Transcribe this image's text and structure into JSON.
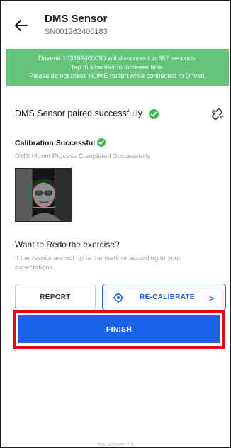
{
  "header": {
    "title": "DMS Sensor",
    "serial": "SN001262400183"
  },
  "banner": {
    "line1": "Driveri# 103182400090 will disconnect in 357 seconds.",
    "line2": "Tap this banner to increase time.",
    "line3": "Please do not press HOME button while connected to Driveri.",
    "color": "#66c37c"
  },
  "pairing": {
    "status_text": "DMS Sensor paired successfully",
    "status_icon": "check-circle-icon",
    "action_icon": "unlink-icon"
  },
  "calibration": {
    "title": "Calibration Successful",
    "subtitle": "DMS Mount Process Completed Successfully",
    "image_icon": "camera-preview-face"
  },
  "redo": {
    "title": "Want to Redo the exercise?",
    "description": "If the results are not up to the mark or according to your expectations."
  },
  "actions": {
    "report_label": "REPORT",
    "recalibrate_label": "RE-CALIBRATE",
    "recalibrate_icon": "target-icon",
    "recalibrate_arrow": ">",
    "finish_label": "FINISH"
  },
  "colors": {
    "primary": "#1a63e8",
    "success": "#43b555",
    "highlight": "#e00d18"
  },
  "footer": {
    "version": "App Version: 7.1"
  }
}
